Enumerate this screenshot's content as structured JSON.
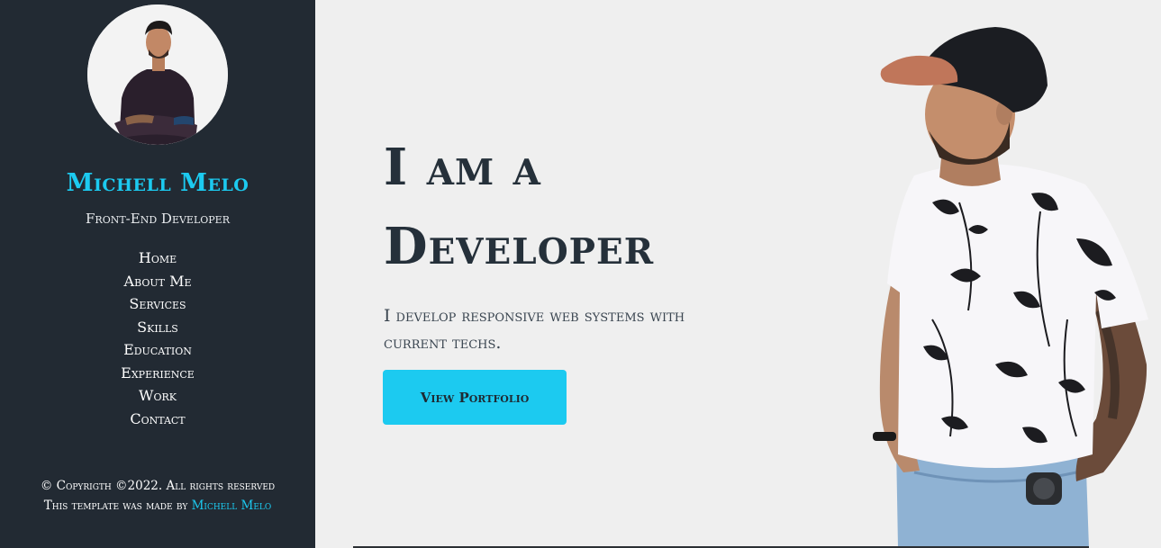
{
  "sidebar": {
    "name": "Michell Melo",
    "role": "Front-End Developer",
    "nav": [
      "Home",
      "About Me",
      "Services",
      "Skills",
      "Education",
      "Experience",
      "Work",
      "Contact"
    ],
    "footer_copyright": "© Copyrigth ©2022. All rights reserved",
    "footer_made_by": "This template was made by",
    "footer_author": "Michell Melo"
  },
  "hero": {
    "title_line1": "I am a",
    "title_line2": "Developer",
    "description": "I develop responsive web systems with current techs.",
    "cta_label": "View Portfolio"
  },
  "colors": {
    "sidebar_bg": "#222a33",
    "accent": "#1ccaf0",
    "main_bg": "#efefef",
    "title_text": "#25303a"
  },
  "icons": [
    "avatar-photo",
    "hero-portrait"
  ]
}
